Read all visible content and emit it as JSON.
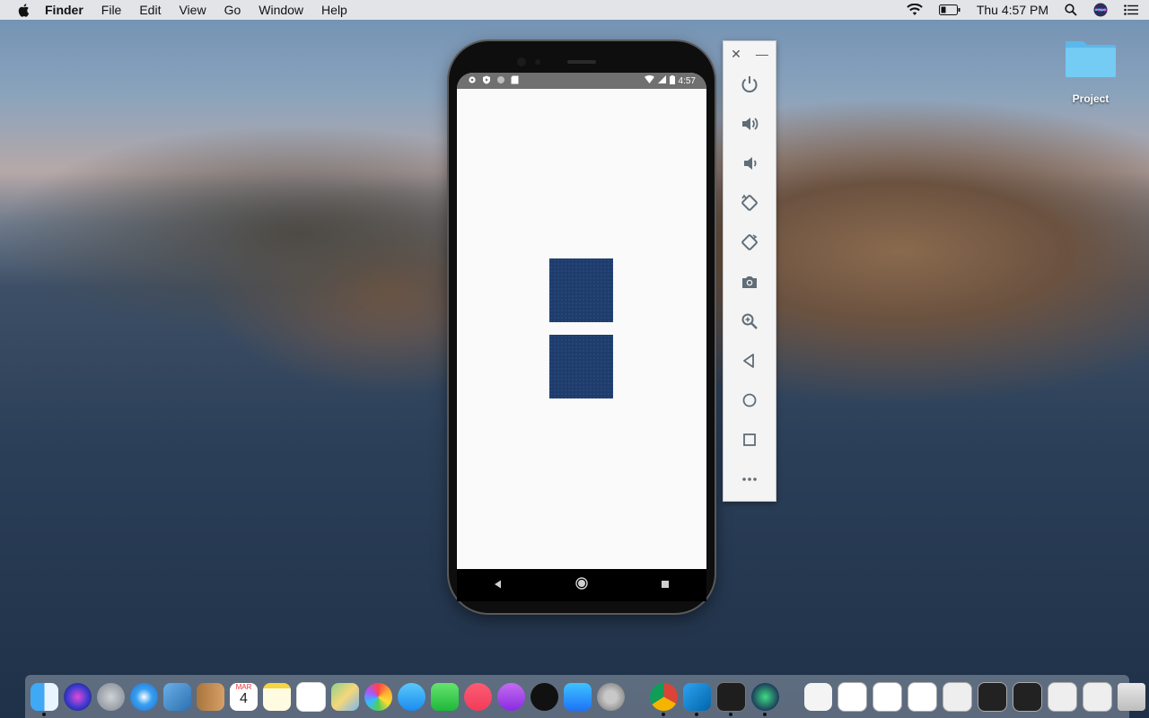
{
  "menubar": {
    "app_name": "Finder",
    "menus": [
      "File",
      "Edit",
      "View",
      "Go",
      "Window",
      "Help"
    ],
    "clock": "Thu 4:57 PM"
  },
  "desktop": {
    "folder_label": "Project"
  },
  "phone": {
    "status_time": "4:57",
    "squares": 2,
    "square_color": "#1f3c6b"
  },
  "emulator_panel": {
    "controls": [
      "power-icon",
      "volume-up-icon",
      "volume-down-icon",
      "rotate-left-icon",
      "rotate-right-icon",
      "camera-icon",
      "zoom-icon",
      "back-icon",
      "home-icon",
      "overview-icon",
      "more-icon"
    ]
  },
  "dock": {
    "calendar_month": "MAR",
    "calendar_day": "4"
  }
}
